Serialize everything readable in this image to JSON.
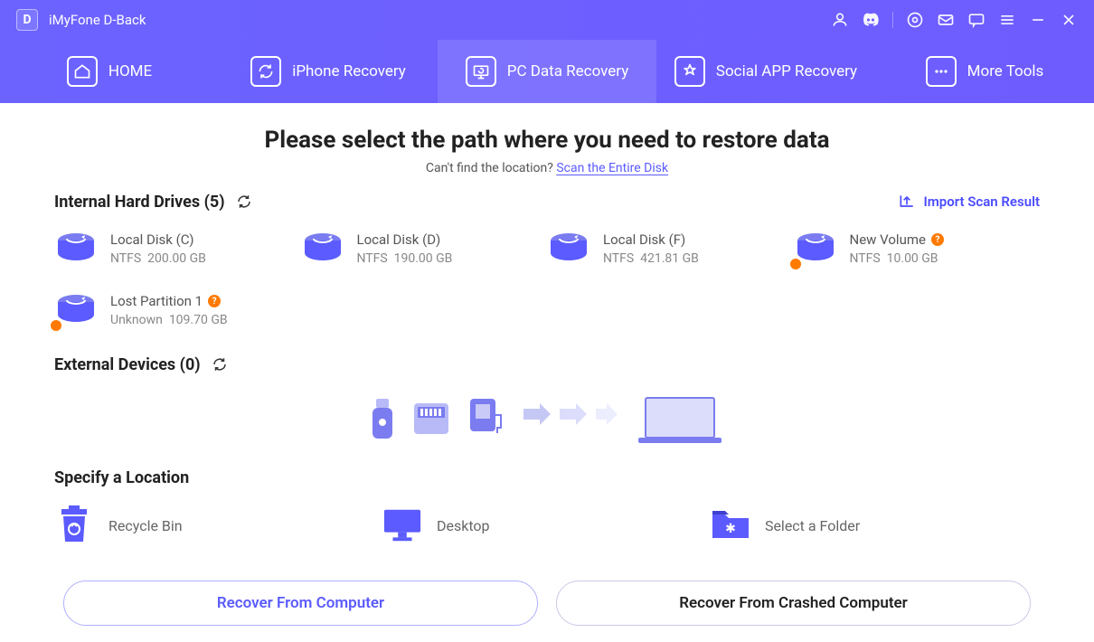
{
  "titlebar": {
    "app_name": "iMyFone D-Back",
    "logo_letter": "D"
  },
  "nav": {
    "tabs": [
      {
        "label": "HOME"
      },
      {
        "label": "iPhone Recovery"
      },
      {
        "label": "PC Data Recovery"
      },
      {
        "label": "Social APP Recovery"
      },
      {
        "label": "More Tools"
      }
    ],
    "active_index": 2
  },
  "main": {
    "title": "Please select the path where you need to restore data",
    "subtitle_prefix": "Can't find the location? ",
    "subtitle_link": "Scan the Entire Disk"
  },
  "internal": {
    "header": "Internal Hard Drives (5)",
    "import_label": "Import Scan Result",
    "drives": [
      {
        "name": "Local Disk (C)",
        "fs": "NTFS",
        "size": "200.00 GB",
        "warn": false
      },
      {
        "name": "Local Disk (D)",
        "fs": "NTFS",
        "size": "190.00 GB",
        "warn": false
      },
      {
        "name": "Local Disk (F)",
        "fs": "NTFS",
        "size": "421.81 GB",
        "warn": false
      },
      {
        "name": "New Volume",
        "fs": "NTFS",
        "size": "10.00 GB",
        "warn": true,
        "qmark": true
      },
      {
        "name": "Lost Partition 1",
        "fs": "Unknown",
        "size": "109.70 GB",
        "warn": true,
        "qmark": true
      }
    ]
  },
  "external": {
    "header": "External Devices (0)"
  },
  "specify": {
    "header": "Specify a Location",
    "items": [
      {
        "label": "Recycle Bin"
      },
      {
        "label": "Desktop"
      },
      {
        "label": "Select a Folder"
      }
    ]
  },
  "buttons": {
    "primary": "Recover From Computer",
    "secondary": "Recover From Crashed Computer"
  }
}
